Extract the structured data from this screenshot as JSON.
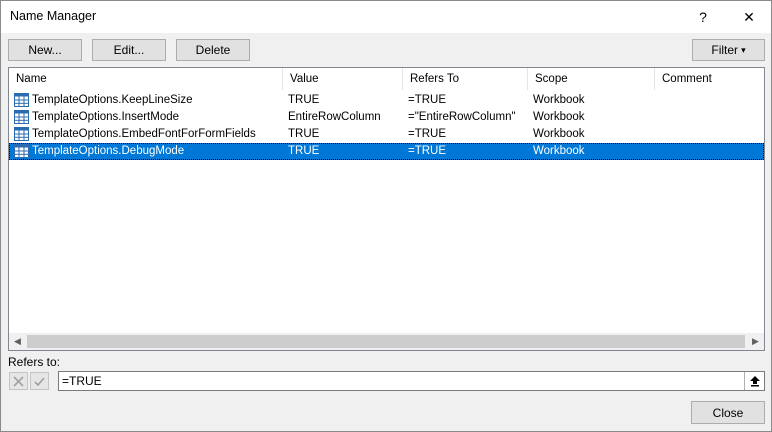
{
  "window": {
    "title": "Name Manager",
    "help_glyph": "?",
    "close_glyph": "✕"
  },
  "toolbar": {
    "new_label": "New...",
    "edit_label": "Edit...",
    "delete_label": "Delete",
    "filter_label": "Filter",
    "filter_arrow": "▾"
  },
  "list": {
    "columns": {
      "name": "Name",
      "value": "Value",
      "refers_to": "Refers To",
      "scope": "Scope",
      "comment": "Comment"
    },
    "rows": [
      {
        "name": "TemplateOptions.KeepLineSize",
        "value": "TRUE",
        "refers_to": "=TRUE",
        "scope": "Workbook",
        "comment": "",
        "selected": false,
        "icon": "named-range-table-icon"
      },
      {
        "name": "TemplateOptions.InsertMode",
        "value": "EntireRowColumn",
        "refers_to": "=\"EntireRowColumn\"",
        "scope": "Workbook",
        "comment": "",
        "selected": false,
        "icon": "named-range-table-icon"
      },
      {
        "name": "TemplateOptions.EmbedFontForFormFields",
        "value": "TRUE",
        "refers_to": "=TRUE",
        "scope": "Workbook",
        "comment": "",
        "selected": false,
        "icon": "named-range-table-icon"
      },
      {
        "name": "TemplateOptions.DebugMode",
        "value": "TRUE",
        "refers_to": "=TRUE",
        "scope": "Workbook",
        "comment": "",
        "selected": true,
        "icon": "named-range-table-icon"
      }
    ],
    "scroll_left_glyph": "◀",
    "scroll_right_glyph": "▶"
  },
  "refers": {
    "label": "Refers to:",
    "value": "=TRUE"
  },
  "footer": {
    "close_label": "Close"
  },
  "colors": {
    "selection": "#0078d7",
    "window_bg": "#f0f0f0",
    "button_bg": "#e1e1e1"
  }
}
